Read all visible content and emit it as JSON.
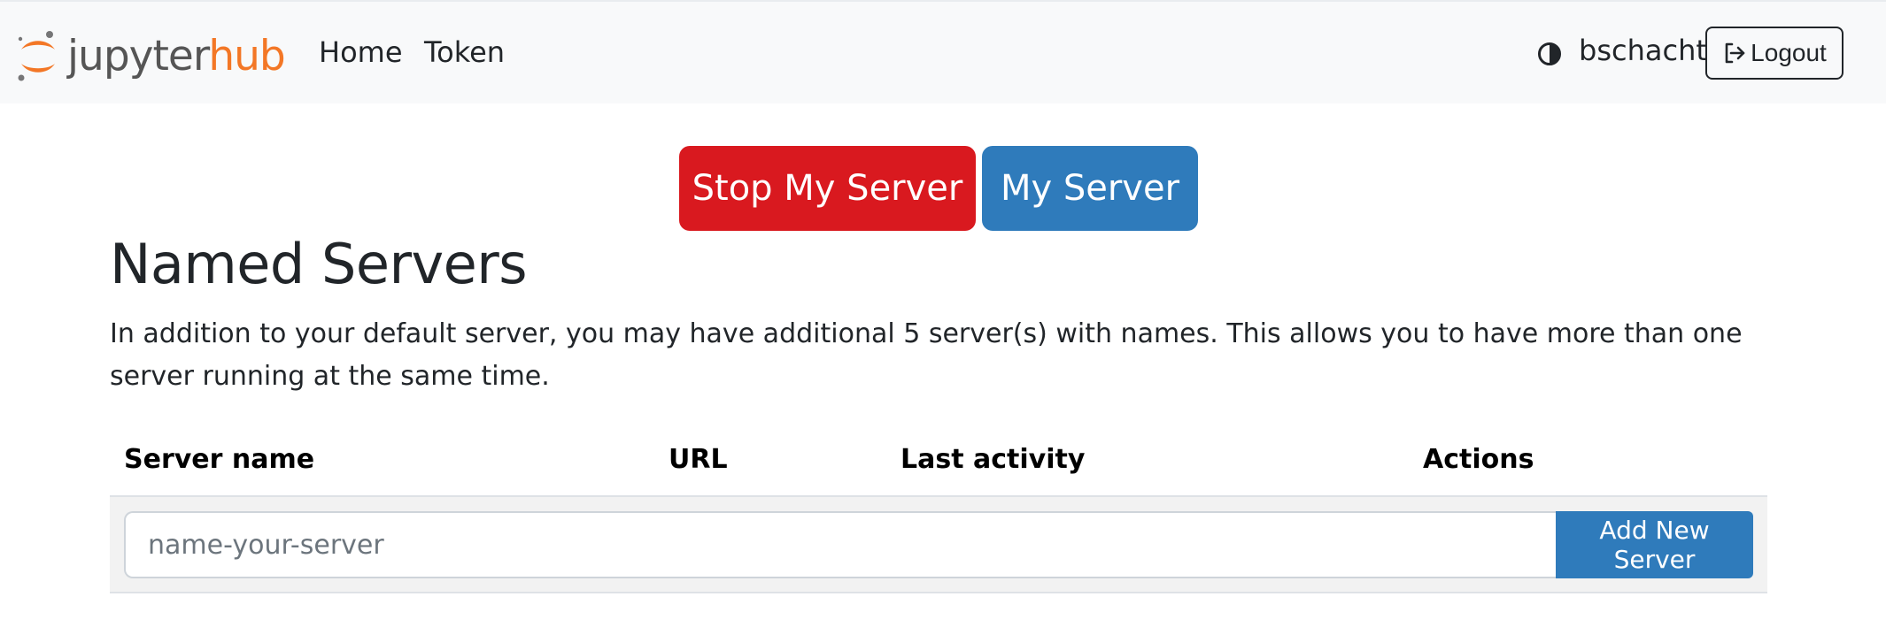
{
  "brand": {
    "name_part1": "jupyter",
    "name_part2": "hub",
    "accent_color": "#f37726"
  },
  "nav": {
    "home": "Home",
    "token": "Token"
  },
  "user": {
    "theme_icon": "contrast-icon",
    "username": "bschacht",
    "logout_label": "Logout",
    "logout_icon": "sign-out-icon"
  },
  "actions": {
    "stop_label": "Stop My Server",
    "stop_color": "#d9191f",
    "my_server_label": "My Server",
    "my_server_color": "#2f7bbb"
  },
  "named_servers": {
    "title": "Named Servers",
    "description": "In addition to your default server, you may have additional 5 server(s) with names. This allows you to have more than one server running at the same time.",
    "columns": [
      "Server name",
      "URL",
      "Last activity",
      "Actions"
    ],
    "input_placeholder": "name-your-server",
    "add_label": "Add New Server"
  }
}
